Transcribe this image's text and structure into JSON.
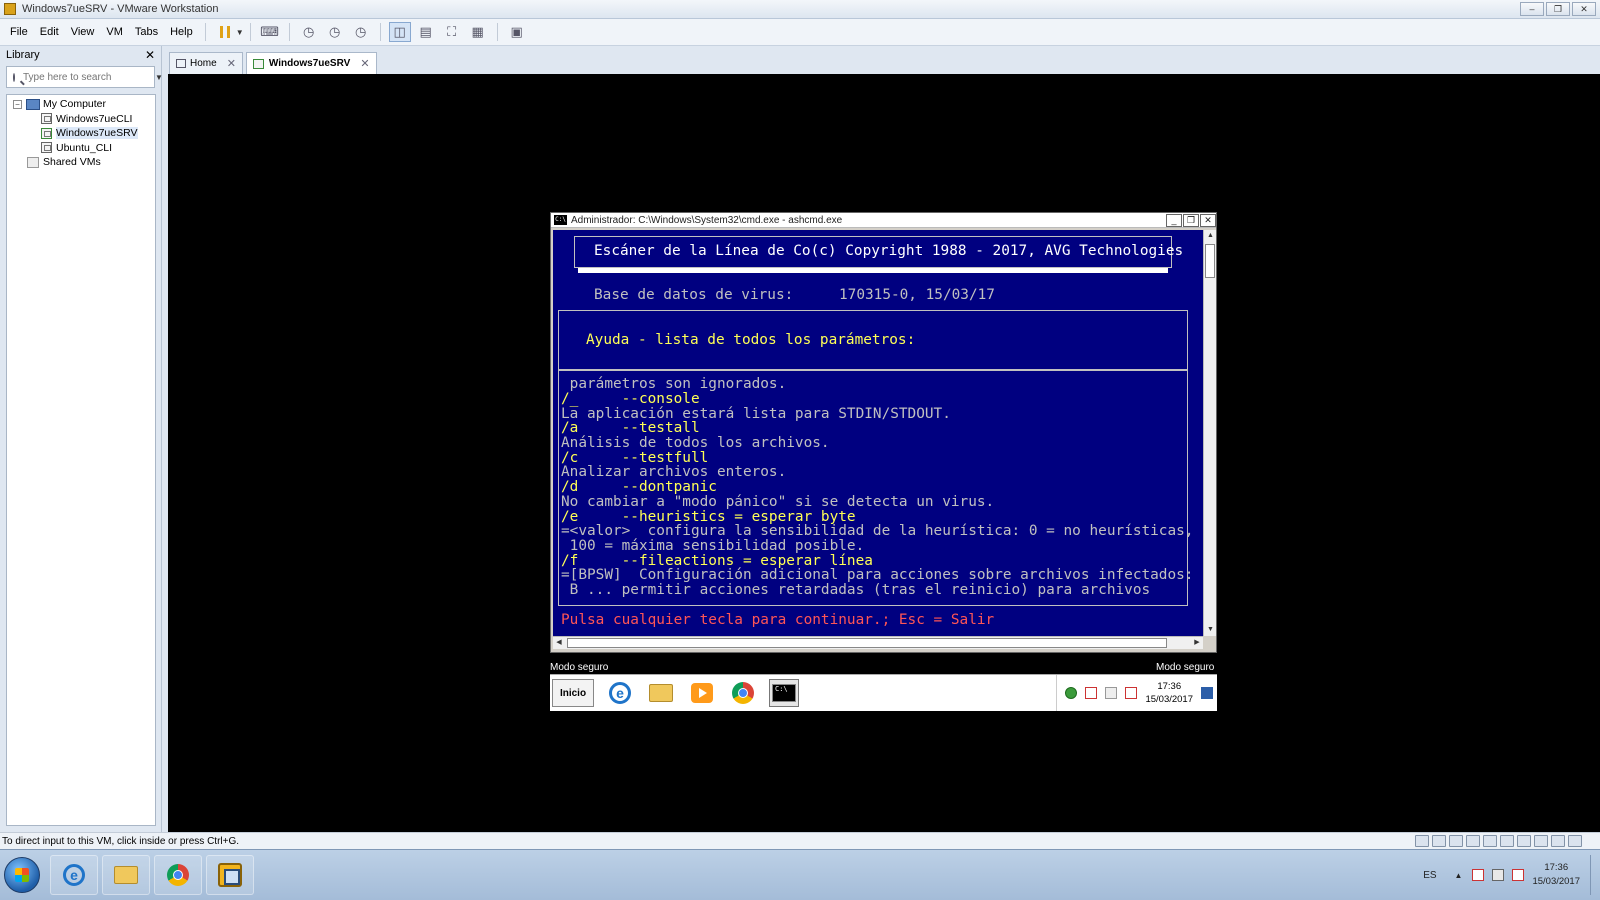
{
  "window": {
    "title": "Windows7ueSRV - VMware Workstation"
  },
  "menu": [
    "File",
    "Edit",
    "View",
    "VM",
    "Tabs",
    "Help"
  ],
  "library": {
    "title": "Library",
    "search_placeholder": "Type here to search",
    "tree": {
      "root": "My Computer",
      "vms": [
        "Windows7ueCLI",
        "Windows7ueSRV",
        "Ubuntu_CLI"
      ],
      "shared": "Shared VMs"
    }
  },
  "tabs": [
    {
      "label": "Home"
    },
    {
      "label": "Windows7ueSRV"
    }
  ],
  "cmd": {
    "title": "Administrador: C:\\Windows\\System32\\cmd.exe - ashcmd.exe",
    "icon_text": "C:\\",
    "header": "Escáner de la Línea de Co(c) Copyright 1988 - 2017, AVG Technologies",
    "db_label": "Base de datos de virus:",
    "db_value": "170315-0, 15/03/17",
    "help_title": "Ayuda - lista de todos los parámetros:",
    "lines": [
      " parámetros son ignorados.",
      "/_     --console",
      "La aplicación estará lista para STDIN/STDOUT.",
      "/a     --testall",
      "Análisis de todos los archivos.",
      "/c     --testfull",
      "Analizar archivos enteros.",
      "/d     --dontpanic",
      "No cambiar a \"modo pánico\" si se detecta un virus.",
      "/e     --heuristics = esperar byte",
      "=<valor>  configura la sensibilidad de la heurística: 0 = no heurísticas,",
      " 100 = máxima sensibilidad posible.",
      "/f     --fileactions = esperar línea",
      "=[BPSW]  Configuración adicional para acciones sobre archivos infectados:",
      " B ... permitir acciones retardadas (tras el reinicio) para archivos"
    ],
    "prompt": "Pulsa cualquier tecla para continuar.; Esc = Salir"
  },
  "guest": {
    "safe_mode": "Modo seguro",
    "start_label": "Inicio",
    "clock_time": "17:36",
    "clock_date": "15/03/2017"
  },
  "status": {
    "text": "To direct input to this VM, click inside or press Ctrl+G."
  },
  "host": {
    "lang": "ES",
    "clock_time": "17:36",
    "clock_date": "15/03/2017"
  }
}
